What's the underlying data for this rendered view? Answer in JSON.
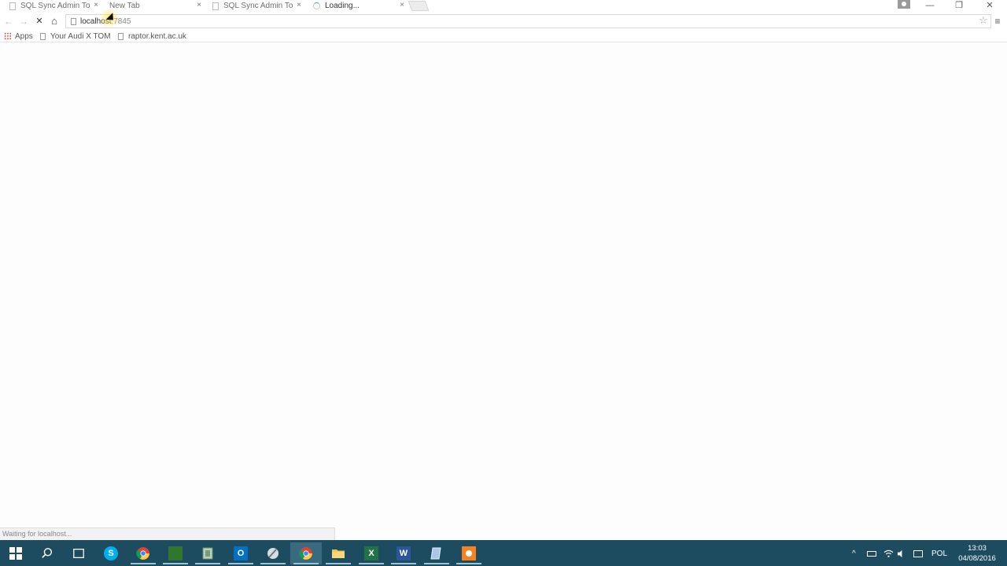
{
  "tabs": [
    {
      "title": "SQL Sync Admin To",
      "close": "×",
      "state": "inactive"
    },
    {
      "title": "New Tab",
      "close": "×",
      "state": "inactive"
    },
    {
      "title": "SQL Sync Admin To",
      "close": "×",
      "state": "inactive"
    },
    {
      "title": "Loading...",
      "close": "×",
      "state": "active"
    }
  ],
  "window_controls": {
    "minimize": "—",
    "restore": "❐",
    "close": "✕"
  },
  "toolbar": {
    "back": "←",
    "forward": "→",
    "stop": "✕",
    "home": "⌂",
    "url_host": "localhost",
    "url_port": ":7845",
    "star": "☆",
    "menu": "≡"
  },
  "bookmarks": [
    {
      "label": "Apps",
      "icon": "apps-grid-icon"
    },
    {
      "label": "Your Audi X TOM",
      "icon": "page-icon"
    },
    {
      "label": "raptor.kent.ac.uk",
      "icon": "page-icon"
    }
  ],
  "status_bar": {
    "text": "Waiting for localhost..."
  },
  "taskbar": {
    "apps": [
      {
        "name": "start",
        "icon": "windows-icon"
      },
      {
        "name": "search",
        "icon": "search-icon"
      },
      {
        "name": "task-view",
        "icon": "task-view-icon"
      },
      {
        "name": "skype",
        "icon": "skype-icon",
        "glyph": "S",
        "color": "#00aff0"
      },
      {
        "name": "chrome",
        "icon": "chrome-icon"
      },
      {
        "name": "project",
        "icon": "project-icon",
        "color": "#31752f"
      },
      {
        "name": "sql",
        "icon": "database-icon",
        "color": "#7a9a7a"
      },
      {
        "name": "outlook",
        "icon": "outlook-icon",
        "glyph": "O",
        "color": "#0072c6"
      },
      {
        "name": "paint",
        "icon": "paint-icon"
      },
      {
        "name": "chrome-active",
        "icon": "chrome-icon"
      },
      {
        "name": "explorer",
        "icon": "folder-icon",
        "color": "#f6c342"
      },
      {
        "name": "excel",
        "icon": "excel-icon",
        "glyph": "X",
        "color": "#217346"
      },
      {
        "name": "word",
        "icon": "word-icon",
        "glyph": "W",
        "color": "#2b579a"
      },
      {
        "name": "notes",
        "icon": "notes-icon",
        "color": "#a9c7e8"
      },
      {
        "name": "recorder",
        "icon": "record-icon",
        "color": "#f5821f"
      }
    ],
    "tray": {
      "chevron": "^",
      "lang": "POL",
      "time": "13:03",
      "date": "04/08/2016"
    }
  }
}
